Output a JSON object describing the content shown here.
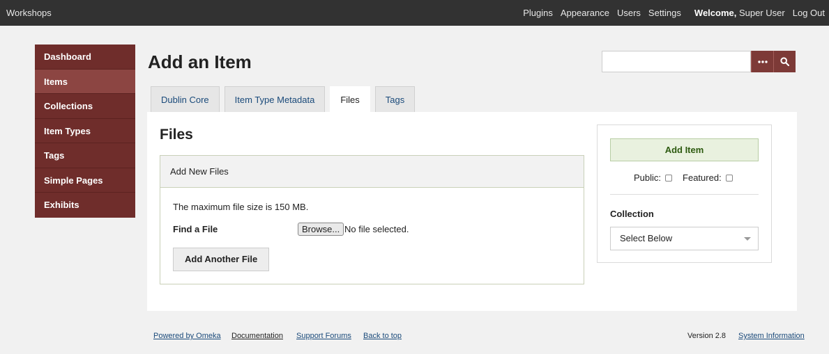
{
  "topbar": {
    "site_title": "Workshops",
    "nav": [
      "Plugins",
      "Appearance",
      "Users",
      "Settings"
    ],
    "welcome_label": "Welcome,",
    "welcome_user": "Super User",
    "logout": "Log Out"
  },
  "sidebar": {
    "items": [
      {
        "label": "Dashboard"
      },
      {
        "label": "Items"
      },
      {
        "label": "Collections"
      },
      {
        "label": "Item Types"
      },
      {
        "label": "Tags"
      },
      {
        "label": "Simple Pages"
      },
      {
        "label": "Exhibits"
      }
    ]
  },
  "page": {
    "title": "Add an Item"
  },
  "search": {
    "more_icon": "ellipsis-icon",
    "search_icon": "magnifier-icon"
  },
  "tabs": [
    "Dublin Core",
    "Item Type Metadata",
    "Files",
    "Tags"
  ],
  "files_panel": {
    "title": "Files",
    "box_title": "Add New Files",
    "max_size": "The maximum file size is 150 MB.",
    "find_label": "Find a File",
    "browse_label": "Browse...",
    "no_file": "No file selected.",
    "add_another": "Add Another File"
  },
  "side_panel": {
    "add_item": "Add Item",
    "public_label": "Public:",
    "featured_label": "Featured:",
    "collection_label": "Collection",
    "collection_value": "Select Below"
  },
  "footer": {
    "powered": "Powered by Omeka",
    "documentation": "Documentation",
    "support": "Support Forums",
    "back_top": "Back to top",
    "version": "Version 2.8",
    "system_info": "System Information"
  },
  "colors": {
    "topbar": "#323232",
    "sidebar": "#6f2d2b",
    "sidebar_active": "#8c4542",
    "accent_button": "#7d3a37",
    "link": "#1a4a7a"
  }
}
